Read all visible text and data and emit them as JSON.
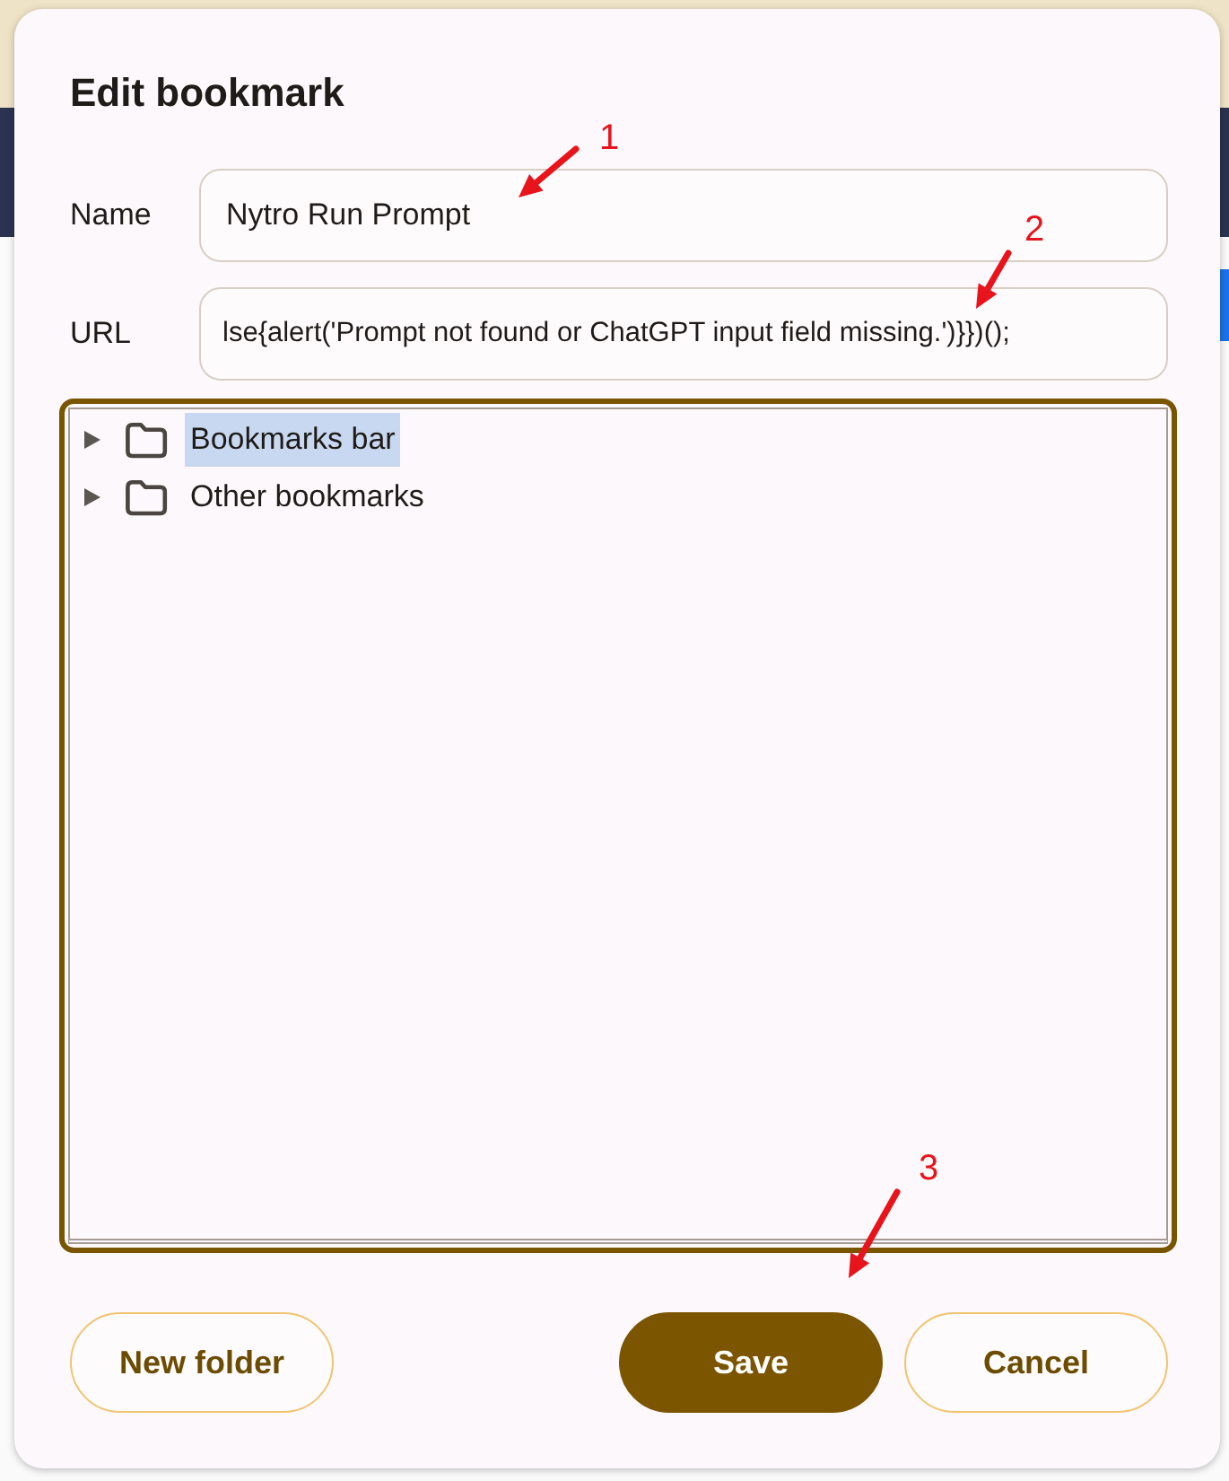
{
  "dialog": {
    "title": "Edit bookmark"
  },
  "fields": [
    {
      "label": "Name",
      "value": "Nytro Run Prompt"
    },
    {
      "label": "URL",
      "value": "lse{alert('Prompt not found or ChatGPT input field missing.')}})();"
    }
  ],
  "folder_tree": [
    {
      "label": "Bookmarks bar",
      "expanded": false,
      "selected": true
    },
    {
      "label": "Other bookmarks",
      "expanded": false,
      "selected": false
    }
  ],
  "buttons": [
    {
      "label": "New folder",
      "kind": "outline"
    },
    {
      "label": "Save",
      "kind": "primary"
    },
    {
      "label": "Cancel",
      "kind": "outline"
    }
  ],
  "annotations": [
    {
      "label": "1"
    },
    {
      "label": "2"
    },
    {
      "label": "3"
    }
  ]
}
